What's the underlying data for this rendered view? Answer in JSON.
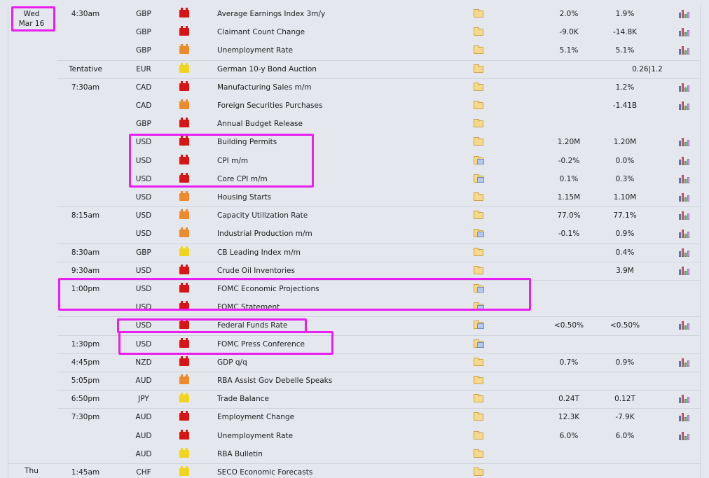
{
  "days": [
    {
      "weekday": "Wed",
      "date": "Mar 16"
    },
    {
      "weekday": "Thu"
    }
  ],
  "events": [
    {
      "time": "4:30am",
      "currency": "GBP",
      "impact": "high",
      "event": "Average Earnings Index 3m/y",
      "actual": "2.0%",
      "forecast": "1.9%",
      "previous": "",
      "doc": false,
      "chart": true
    },
    {
      "time": "",
      "currency": "GBP",
      "impact": "high",
      "event": "Claimant Count Change",
      "actual": "-9.0K",
      "forecast": "-14.8K",
      "previous": "",
      "doc": false,
      "chart": true
    },
    {
      "time": "",
      "currency": "GBP",
      "impact": "med",
      "event": "Unemployment Rate",
      "actual": "5.1%",
      "forecast": "5.1%",
      "previous": "",
      "doc": false,
      "chart": true
    },
    {
      "time": "Tentative",
      "currency": "EUR",
      "impact": "low",
      "event": "German 10-y Bond Auction",
      "actual": "",
      "forecast": "",
      "previous": "0.26|1.2",
      "doc": false,
      "chart": false
    },
    {
      "time": "7:30am",
      "currency": "CAD",
      "impact": "high",
      "event": "Manufacturing Sales m/m",
      "actual": "",
      "forecast": "1.2%",
      "previous": "",
      "doc": false,
      "chart": true
    },
    {
      "time": "",
      "currency": "CAD",
      "impact": "med",
      "event": "Foreign Securities Purchases",
      "actual": "",
      "forecast": "-1.41B",
      "previous": "",
      "doc": false,
      "chart": true
    },
    {
      "time": "",
      "currency": "GBP",
      "impact": "high",
      "event": "Annual Budget Release",
      "actual": "",
      "forecast": "",
      "previous": "",
      "doc": false,
      "chart": false
    },
    {
      "time": "",
      "currency": "USD",
      "impact": "high",
      "event": "Building Permits",
      "actual": "1.20M",
      "forecast": "1.20M",
      "previous": "",
      "doc": false,
      "chart": true
    },
    {
      "time": "",
      "currency": "USD",
      "impact": "high",
      "event": "CPI m/m",
      "actual": "-0.2%",
      "forecast": "0.0%",
      "previous": "",
      "doc": true,
      "chart": true
    },
    {
      "time": "",
      "currency": "USD",
      "impact": "high",
      "event": "Core CPI m/m",
      "actual": "0.1%",
      "forecast": "0.3%",
      "previous": "",
      "doc": true,
      "chart": true
    },
    {
      "time": "",
      "currency": "USD",
      "impact": "med",
      "event": "Housing Starts",
      "actual": "1.15M",
      "forecast": "1.10M",
      "previous": "",
      "doc": false,
      "chart": true
    },
    {
      "time": "8:15am",
      "currency": "USD",
      "impact": "med",
      "event": "Capacity Utilization Rate",
      "actual": "77.0%",
      "forecast": "77.1%",
      "previous": "",
      "doc": false,
      "chart": true
    },
    {
      "time": "",
      "currency": "USD",
      "impact": "med",
      "event": "Industrial Production m/m",
      "actual": "-0.1%",
      "forecast": "0.9%",
      "previous": "",
      "doc": true,
      "chart": true
    },
    {
      "time": "8:30am",
      "currency": "GBP",
      "impact": "low",
      "event": "CB Leading Index m/m",
      "actual": "",
      "forecast": "0.4%",
      "previous": "",
      "doc": false,
      "chart": true
    },
    {
      "time": "9:30am",
      "currency": "USD",
      "impact": "high",
      "event": "Crude Oil Inventories",
      "actual": "",
      "forecast": "3.9M",
      "previous": "",
      "doc": false,
      "chart": true
    },
    {
      "time": "1:00pm",
      "currency": "USD",
      "impact": "high",
      "event": "FOMC Economic Projections",
      "actual": "",
      "forecast": "",
      "previous": "",
      "doc": true,
      "chart": false
    },
    {
      "time": "",
      "currency": "USD",
      "impact": "high",
      "event": "FOMC Statement",
      "actual": "",
      "forecast": "",
      "previous": "",
      "doc": true,
      "chart": false
    },
    {
      "time": "",
      "currency": "USD",
      "impact": "high",
      "event": "Federal Funds Rate",
      "actual": "<0.50%",
      "forecast": "<0.50%",
      "previous": "",
      "doc": true,
      "chart": true
    },
    {
      "time": "1:30pm",
      "currency": "USD",
      "impact": "high",
      "event": "FOMC Press Conference",
      "actual": "",
      "forecast": "",
      "previous": "",
      "doc": true,
      "chart": false
    },
    {
      "time": "4:45pm",
      "currency": "NZD",
      "impact": "high",
      "event": "GDP q/q",
      "actual": "0.7%",
      "forecast": "0.9%",
      "previous": "",
      "doc": false,
      "chart": true
    },
    {
      "time": "5:05pm",
      "currency": "AUD",
      "impact": "med",
      "event": "RBA Assist Gov Debelle Speaks",
      "actual": "",
      "forecast": "",
      "previous": "",
      "doc": false,
      "chart": false
    },
    {
      "time": "6:50pm",
      "currency": "JPY",
      "impact": "low",
      "event": "Trade Balance",
      "actual": "0.24T",
      "forecast": "0.12T",
      "previous": "",
      "doc": false,
      "chart": true
    },
    {
      "time": "7:30pm",
      "currency": "AUD",
      "impact": "high",
      "event": "Employment Change",
      "actual": "12.3K",
      "forecast": "-7.9K",
      "previous": "",
      "doc": false,
      "chart": true
    },
    {
      "time": "",
      "currency": "AUD",
      "impact": "high",
      "event": "Unemployment Rate",
      "actual": "6.0%",
      "forecast": "6.0%",
      "previous": "",
      "doc": false,
      "chart": true
    },
    {
      "time": "",
      "currency": "AUD",
      "impact": "low",
      "event": "RBA Bulletin",
      "actual": "",
      "forecast": "",
      "previous": "",
      "doc": false,
      "chart": false
    },
    {
      "time": "1:45am",
      "currency": "CHF",
      "impact": "low",
      "event": "SECO Economic Forecasts",
      "actual": "",
      "forecast": "",
      "previous": "",
      "doc": false,
      "chart": false
    }
  ],
  "colors": {
    "highlight": "#e91ef0",
    "impact_high": "#d81414",
    "impact_medium": "#ef8a2c",
    "impact_low": "#f1d51c"
  }
}
